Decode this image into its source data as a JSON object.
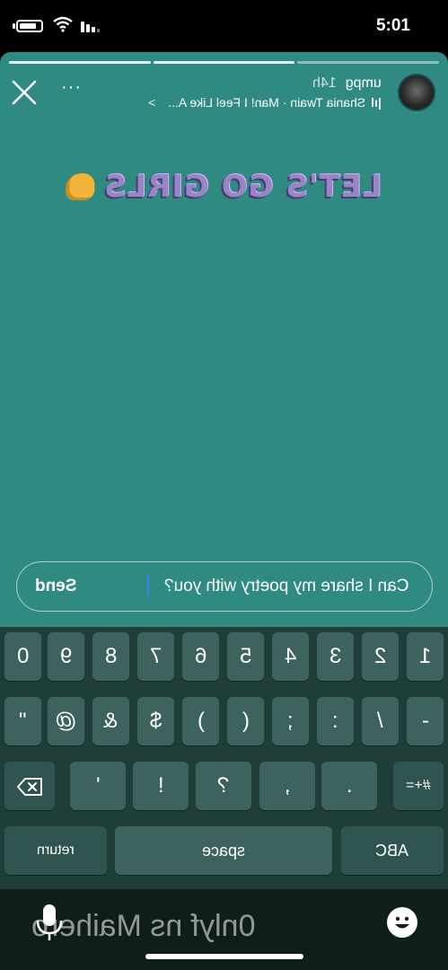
{
  "status": {
    "time": "5:01"
  },
  "story": {
    "username": "umpg",
    "time_ago": "14h",
    "music_icon": "music-bars-icon",
    "music": "Shania Twain · Man! I Feel Like A...",
    "music_chevron": ">",
    "more": "···",
    "sticker_text": "LET'S GO GIRLS",
    "sticker_emoji": "flexed-biceps-icon"
  },
  "reply": {
    "text": "Can I share my poetry with you?",
    "send_label": "Send"
  },
  "keyboard": {
    "row1": [
      "1",
      "2",
      "3",
      "4",
      "5",
      "6",
      "7",
      "8",
      "9",
      "0"
    ],
    "row2": [
      "-",
      "/",
      ":",
      ";",
      "(",
      ")",
      "$",
      "&",
      "@",
      "\""
    ],
    "row3": [
      "#+=",
      ".",
      ",",
      "?",
      "!",
      "'"
    ],
    "row4": {
      "abc": "ABC",
      "space": "space",
      "return": "return"
    }
  },
  "watermark": "0nlyf ns Maihero"
}
